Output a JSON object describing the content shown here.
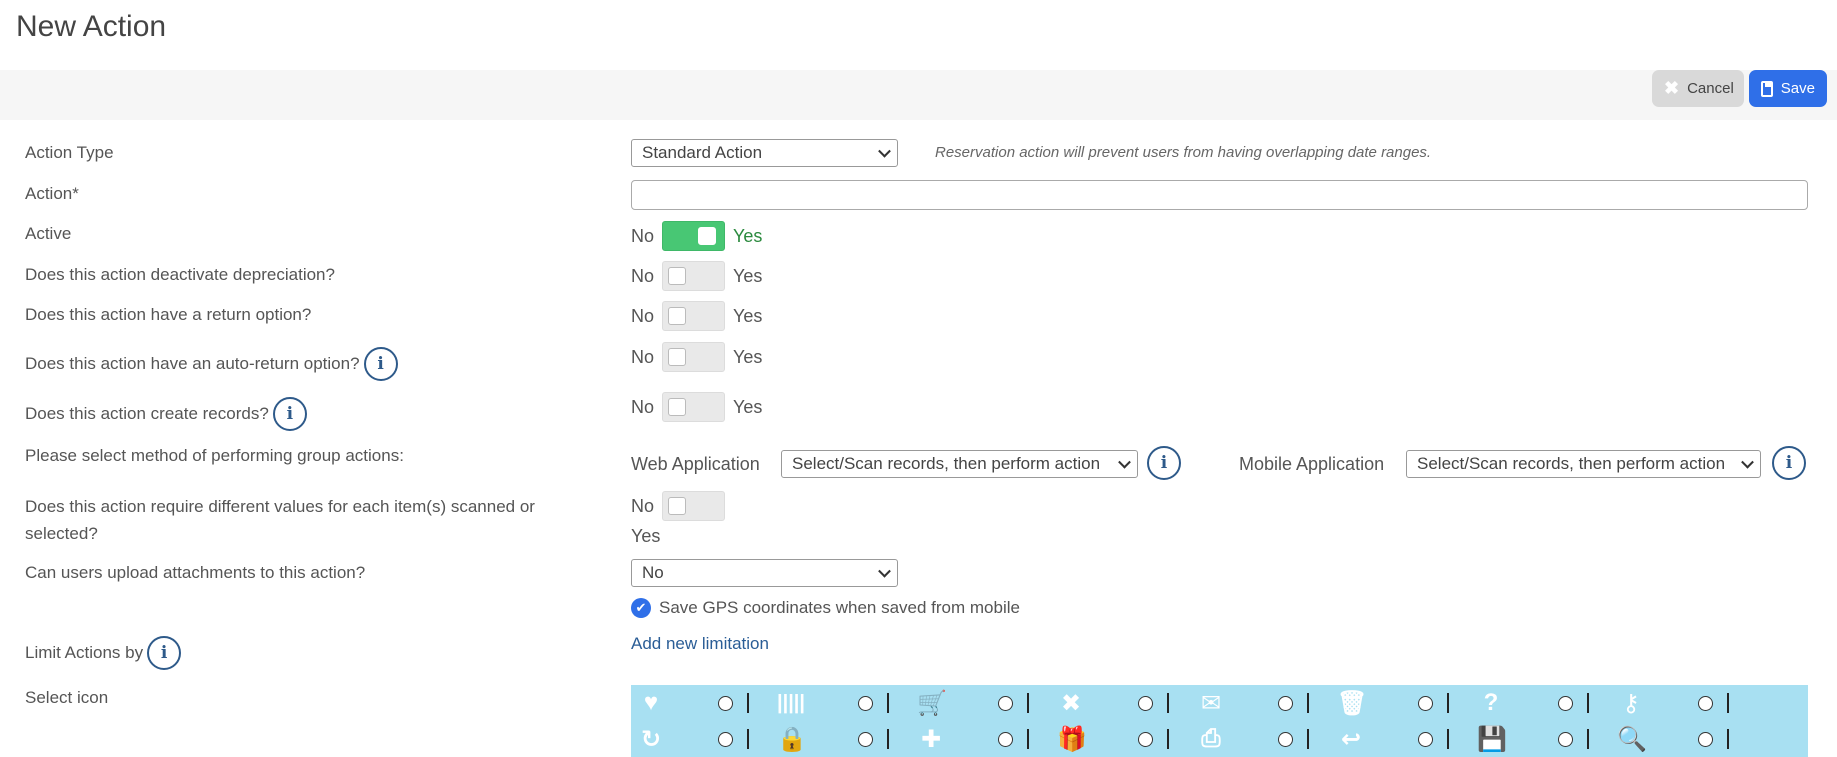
{
  "title": "New Action",
  "toolbar": {
    "cancel_label": "Cancel",
    "save_label": "Save"
  },
  "form": {
    "action_type": {
      "label": "Action Type",
      "value": "Standard Action",
      "hint": "Reservation action will prevent users from having overlapping date ranges."
    },
    "action": {
      "label": "Action*",
      "value": ""
    },
    "toggles": {
      "no_label": "No",
      "yes_label": "Yes",
      "active": {
        "label": "Active",
        "on": true
      },
      "deactivate_depreciation": {
        "label": "Does this action deactivate depreciation?",
        "on": false
      },
      "return_option": {
        "label": "Does this action have a return option?",
        "on": false
      },
      "auto_return": {
        "label": "Does this action have an auto-return option?",
        "on": false
      },
      "create_records": {
        "label": "Does this action create records?",
        "on": false
      },
      "different_values": {
        "label": "Does this action require different values for each item(s) scanned or selected?",
        "on": false
      }
    },
    "group_actions": {
      "label": "Please select method of performing group actions:",
      "web_label": "Web Application",
      "web_value": "Select/Scan records, then perform action",
      "mobile_label": "Mobile Application",
      "mobile_value": "Select/Scan records, then perform action"
    },
    "attachments": {
      "label": "Can users upload attachments to this action?",
      "value": "No"
    },
    "gps": {
      "label": "Save GPS coordinates when saved from mobile",
      "checked": true
    },
    "limit": {
      "label": "Limit Actions by",
      "link": "Add new limitation"
    },
    "select_icon": {
      "label": "Select icon",
      "row1": [
        "heart-icon",
        "barcode-icon",
        "cart-icon",
        "close-x-icon",
        "envelope-icon",
        "trash-icon",
        "question-icon",
        "key-icon"
      ],
      "row2": [
        "refresh-icon",
        "lock-icon",
        "plus-icon",
        "gift-icon",
        "printer-icon",
        "return-icon",
        "save-disk-icon",
        "search-icon"
      ]
    },
    "info_glyph": "i"
  },
  "colors": {
    "primary": "#2f6fe8",
    "toggle_on": "#48c774",
    "icon_panel": "#a8e0f2",
    "info": "#2e5a8a"
  }
}
